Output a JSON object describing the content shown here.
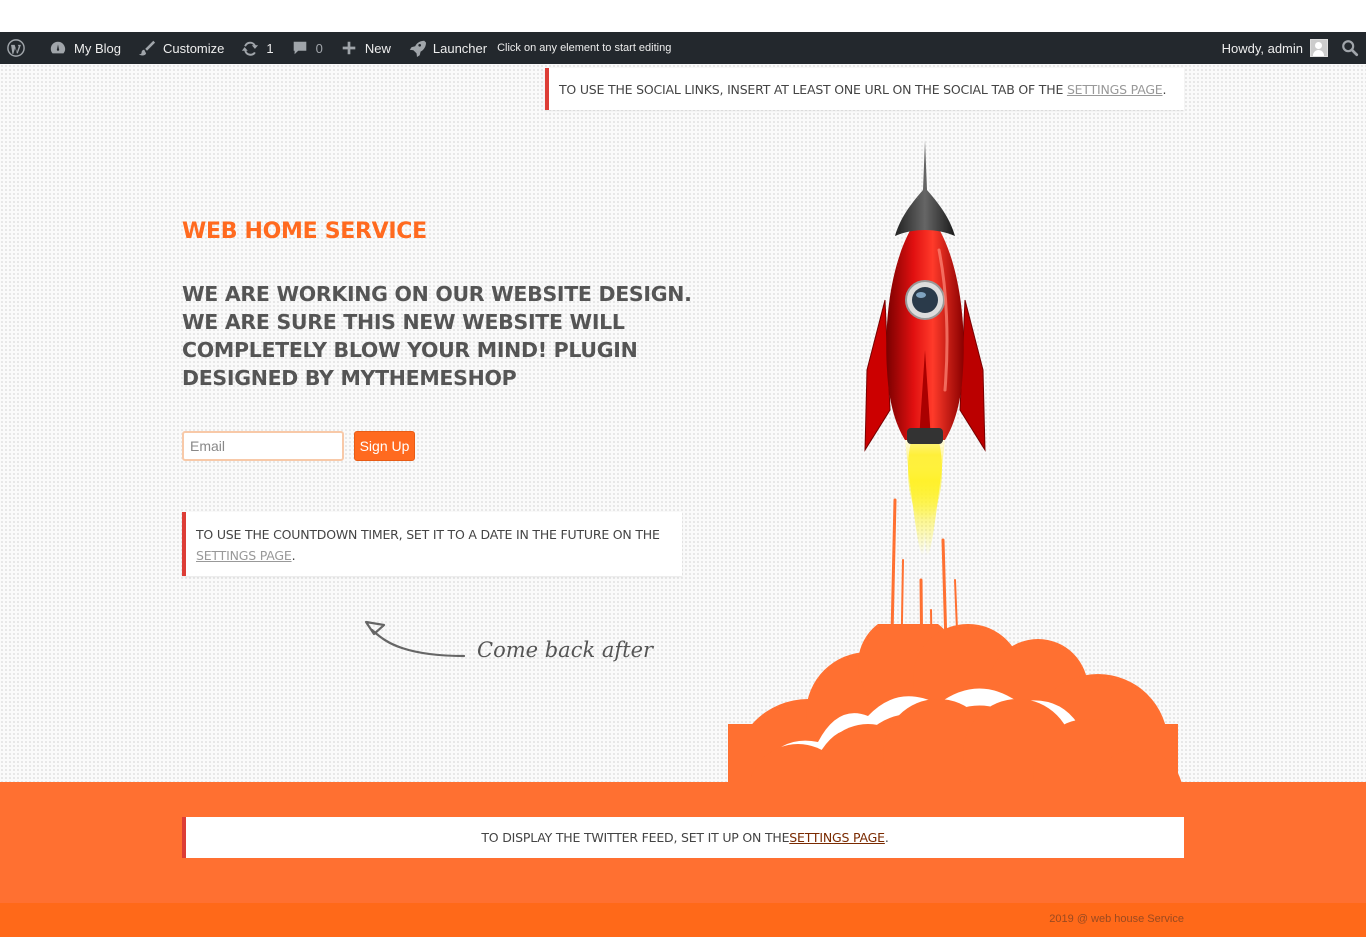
{
  "adminbar": {
    "site_name": "My Blog",
    "customize": "Customize",
    "updates_count": "1",
    "comments_count": "0",
    "new_label": "New",
    "launcher_label": "Launcher",
    "hint": "Click on any element to start editing",
    "howdy": "Howdy, admin"
  },
  "notices": {
    "social_text": "TO USE THE SOCIAL LINKS, INSERT AT LEAST ONE URL ON THE SOCIAL TAB OF THE ",
    "social_link": "SETTINGS PAGE",
    "social_end": " .",
    "countdown_text": "TO USE THE COUNTDOWN TIMER, SET IT TO A DATE IN THE FUTURE ON THE ",
    "countdown_link": "SETTINGS PAGE",
    "countdown_end": ".",
    "twitter_text": "TO DISPLAY THE TWITTER FEED, SET IT UP ON THE ",
    "twitter_link": "SETTINGS PAGE",
    "twitter_end": "."
  },
  "content": {
    "site_title": "WEB HOME SERVICE",
    "headline": "WE ARE WORKING ON OUR WEBSITE DESIGN. WE ARE SURE THIS NEW WEBSITE WILL COMPLETELY BLOW YOUR MIND! PLUGIN DESIGNED BY MYTHEMESHOP",
    "email_placeholder": "Email",
    "signup_label": "Sign Up",
    "come_back": "Come back after"
  },
  "footer": {
    "copyright": "2019 @ web house Service"
  },
  "colors": {
    "accent": "#ff6a1f",
    "adminbar": "#23282d",
    "notice_border": "#dd3d36",
    "footer": "#ff7031"
  },
  "icons": [
    "wordpress-icon",
    "dashboard-icon",
    "brush-icon",
    "updates-icon",
    "comment-icon",
    "plus-icon",
    "rocket-icon",
    "search-icon"
  ]
}
